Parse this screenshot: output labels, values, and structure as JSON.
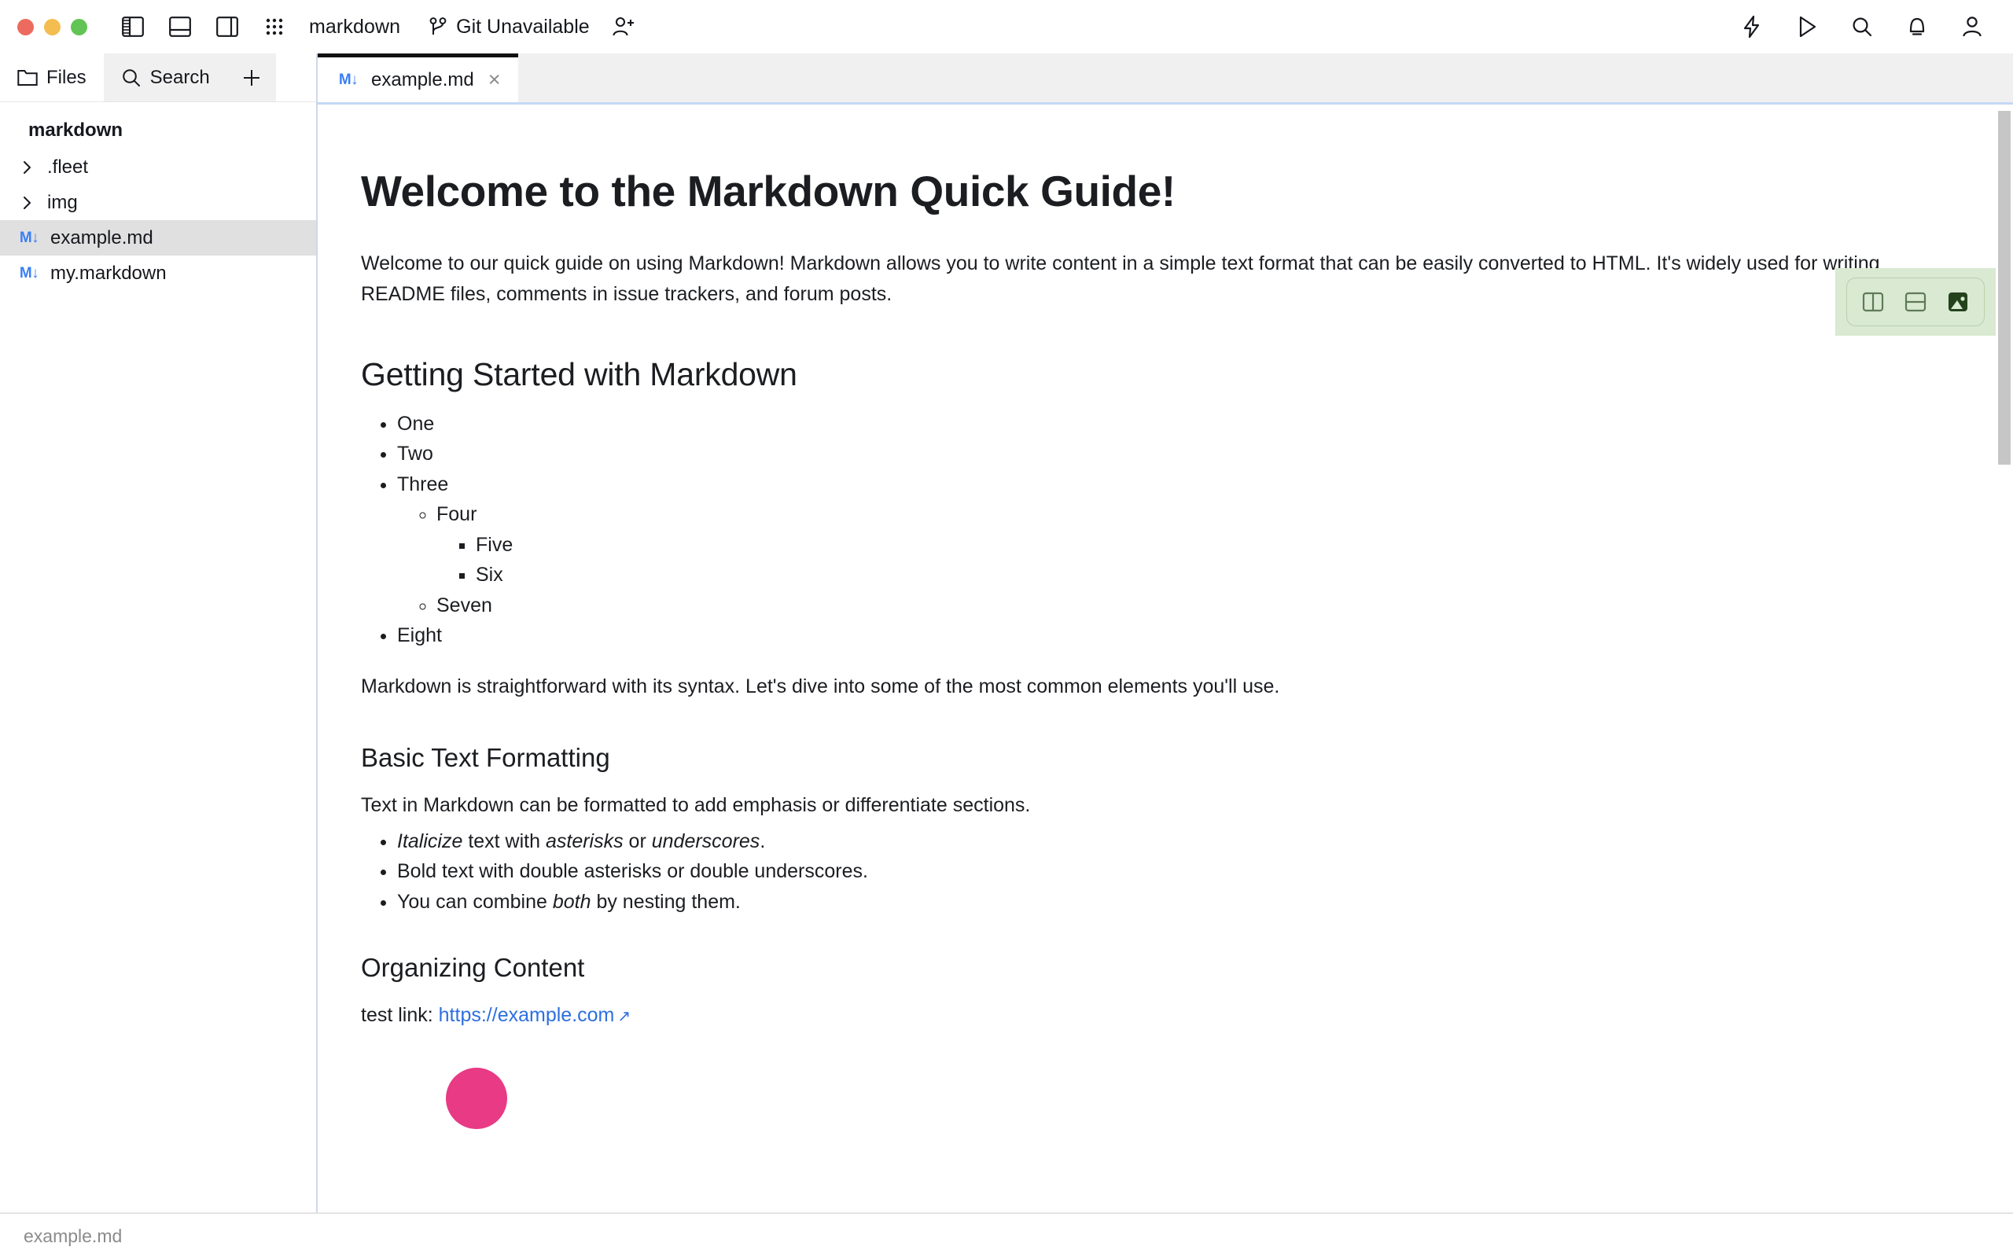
{
  "titlebar": {
    "window_controls": [
      "close",
      "minimize",
      "maximize"
    ],
    "panel_toggles": [
      "left-panel-icon",
      "bottom-panel-icon",
      "right-panel-icon"
    ],
    "grid_icon": "grid-icon",
    "project_title": "markdown",
    "git_status": "Git Unavailable",
    "git_icon": "git-branch-icon",
    "add_user_icon": "add-user-icon",
    "right_icons": [
      "lightning-icon",
      "run-icon",
      "search-icon",
      "notifications-icon",
      "account-icon"
    ]
  },
  "sidebar": {
    "tabs": [
      {
        "label": "Files",
        "icon": "folder-icon",
        "active": true
      },
      {
        "label": "Search",
        "icon": "search-icon",
        "active": false
      }
    ],
    "new_tab_label": "+",
    "root": "markdown",
    "items": [
      {
        "label": ".fleet",
        "type": "folder",
        "expanded": false,
        "selected": false
      },
      {
        "label": "img",
        "type": "folder",
        "expanded": false,
        "selected": false
      },
      {
        "label": "example.md",
        "type": "markdown",
        "selected": true
      },
      {
        "label": "my.markdown",
        "type": "markdown",
        "selected": false
      }
    ]
  },
  "editor": {
    "tab": {
      "label": "example.md",
      "icon": "markdown-icon",
      "close": "×"
    },
    "preview_toolbar": {
      "accent": "#d9e9d2",
      "buttons": [
        {
          "name": "split-vertical",
          "active": false
        },
        {
          "name": "split-horizontal",
          "active": false
        },
        {
          "name": "preview-image",
          "active": true
        }
      ]
    }
  },
  "document": {
    "h1": "Welcome to the Markdown Quick Guide!",
    "intro": "Welcome to our quick guide on using Markdown! Markdown allows you to write content in a simple text format that can be easily converted to HTML. It's widely used for writing README files, comments in issue trackers, and forum posts.",
    "h2_getting_started": "Getting Started with Markdown",
    "list": {
      "one": "One",
      "two": "Two",
      "three": "Three",
      "four": "Four",
      "five": "Five",
      "six": "Six",
      "seven": "Seven",
      "eight": "Eight"
    },
    "syntax_paragraph": "Markdown is straightforward with its syntax. Let's dive into some of the most common elements you'll use.",
    "h3_basic_text": "Basic Text Formatting",
    "basic_text_paragraph": "Text in Markdown can be formatted to add emphasis or differentiate sections.",
    "format_list": {
      "italic_1": "Italicize",
      "italic_rest_a": " text with ",
      "italic_2": "asterisks",
      "italic_rest_b": " or ",
      "italic_3": "underscores",
      "italic_rest_c": ".",
      "bold_line": "Bold text with double asterisks or double underscores.",
      "combine_a": "You can combine ",
      "combine_em": "both",
      "combine_b": " by nesting them."
    },
    "h3_organizing": "Organizing Content",
    "link_prefix": "test link: ",
    "link_text": "https://example.com",
    "link_arrow": "↗"
  },
  "statusbar": {
    "file": "example.md"
  }
}
